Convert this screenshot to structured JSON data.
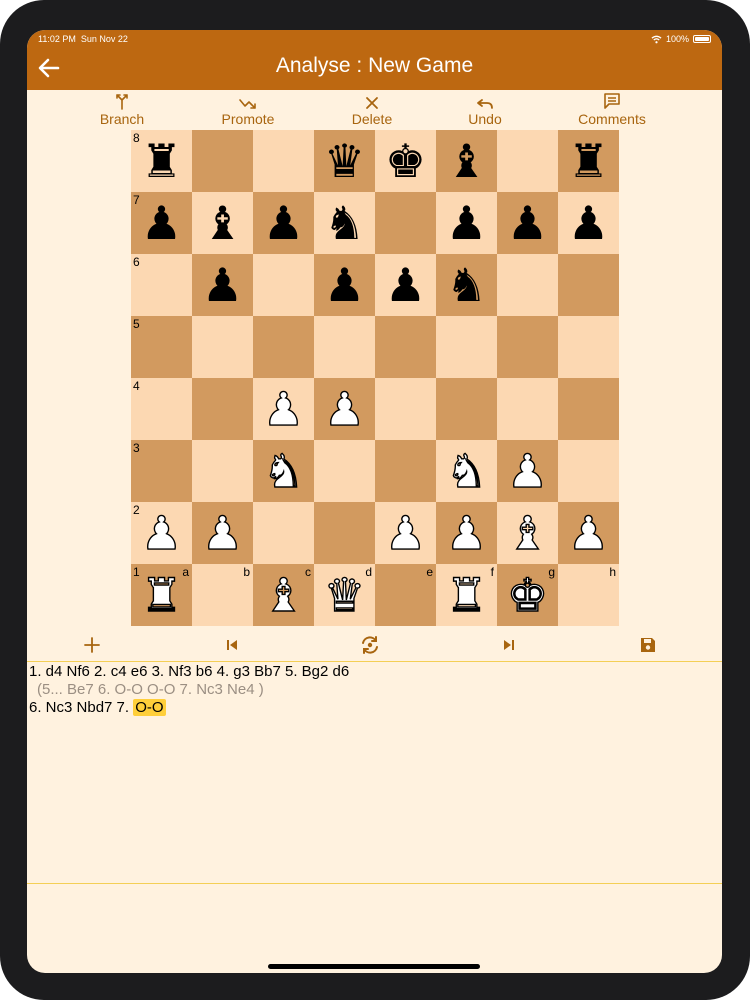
{
  "status": {
    "time": "11:02 PM",
    "date": "Sun Nov 22",
    "battery": "100%"
  },
  "header": {
    "title": "Analyse : New Game"
  },
  "toolbar": {
    "branch": "Branch",
    "promote": "Promote",
    "delete": "Delete",
    "undo": "Undo",
    "comments": "Comments"
  },
  "board": {
    "ranks": [
      "8",
      "7",
      "6",
      "5",
      "4",
      "3",
      "2",
      "1"
    ],
    "files": [
      "a",
      "b",
      "c",
      "d",
      "e",
      "f",
      "g",
      "h"
    ],
    "rows": [
      [
        "♜",
        "",
        "",
        "♛",
        "♚",
        "♝",
        "",
        "♜"
      ],
      [
        "♟",
        "♝",
        "♟",
        "♞",
        "",
        "♟",
        "♟",
        "♟"
      ],
      [
        "",
        "♟",
        "",
        "♟",
        "♟",
        "♞",
        "",
        ""
      ],
      [
        "",
        "",
        "",
        "",
        "",
        "",
        "",
        ""
      ],
      [
        "",
        "",
        "♟",
        "♟",
        "",
        "",
        "",
        ""
      ],
      [
        "",
        "",
        "♞",
        "",
        "",
        "♞",
        "♟",
        ""
      ],
      [
        "♟",
        "♟",
        "",
        "",
        "♟",
        "♟",
        "♝",
        "♟"
      ],
      [
        "♜",
        "",
        "♝",
        "♛",
        "",
        "♜",
        "♚",
        ""
      ]
    ],
    "colors": [
      [
        "b",
        "",
        "",
        "b",
        "b",
        "b",
        "",
        "b"
      ],
      [
        "b",
        "b",
        "b",
        "b",
        "",
        "b",
        "b",
        "b"
      ],
      [
        "",
        "b",
        "",
        "b",
        "b",
        "b",
        "",
        ""
      ],
      [
        "",
        "",
        "",
        "",
        "",
        "",
        "",
        ""
      ],
      [
        "",
        "",
        "w",
        "w",
        "",
        "",
        "",
        ""
      ],
      [
        "",
        "",
        "w",
        "",
        "",
        "w",
        "w",
        ""
      ],
      [
        "w",
        "w",
        "",
        "",
        "w",
        "w",
        "w",
        "w"
      ],
      [
        "w",
        "",
        "w",
        "w",
        "",
        "w",
        "w",
        ""
      ]
    ]
  },
  "moves": {
    "line1": "1. d4 Nf6 2. c4 e6 3. Nf3 b6 4. g3 Bb7 5. Bg2 d6",
    "variation": "(5... Be7 6. O-O O-O 7. Nc3 Ne4 )",
    "line3_prefix": "6. Nc3 Nbd7 7. ",
    "current_move": "O-O"
  },
  "colors": {
    "header": "#bd6811",
    "accent": "#a8650f",
    "background": "#fff2df",
    "light_square": "#fcd8b2",
    "dark_square": "#d29a5f",
    "highlight": "#ffcf3a"
  },
  "icons": [
    "back-arrow-icon",
    "branch-icon",
    "promote-icon",
    "delete-icon",
    "undo-icon",
    "comments-icon",
    "add-icon",
    "first-move-icon",
    "flip-board-icon",
    "last-move-icon",
    "save-icon",
    "wifi-icon",
    "battery-icon"
  ]
}
